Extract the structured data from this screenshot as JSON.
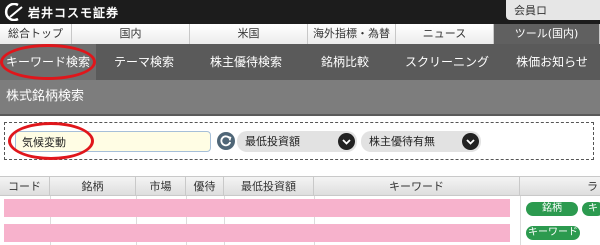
{
  "header": {
    "logo_text": "岩井コスモ証券",
    "top_right_label": "会員ロ"
  },
  "category_tabs": [
    {
      "label": "総合トップ",
      "active": false
    },
    {
      "label": "国内",
      "active": false
    },
    {
      "label": "米国",
      "active": false
    },
    {
      "label": "海外指標・為替",
      "active": false
    },
    {
      "label": "ニュース",
      "active": false
    },
    {
      "label": "ツール(国内)",
      "active": true
    }
  ],
  "subnav": [
    {
      "label": "キーワード検索",
      "active": true
    },
    {
      "label": "テーマ検索",
      "active": false
    },
    {
      "label": "株主優待検索",
      "active": false
    },
    {
      "label": "銘柄比較",
      "active": false
    },
    {
      "label": "スクリーニング",
      "active": false
    },
    {
      "label": "株価お知らせ",
      "active": false
    }
  ],
  "page_title": "株式銘柄検索",
  "search": {
    "value": "気候変動",
    "min_investment_label": "最低投資額",
    "shareholder_benefit_label": "株主優待有無"
  },
  "table": {
    "columns": [
      "コード",
      "銘柄",
      "市場",
      "優待",
      "最低投資額",
      "キーワード",
      "ラ"
    ],
    "rows": [
      {
        "tags": [
          "銘柄",
          "キ"
        ]
      },
      {
        "tags": [
          "キーワード"
        ]
      }
    ]
  },
  "colors": {
    "annotation": "#e0161b",
    "tag_green": "#2c9a4f",
    "row_highlight": "#f7b2cc"
  }
}
